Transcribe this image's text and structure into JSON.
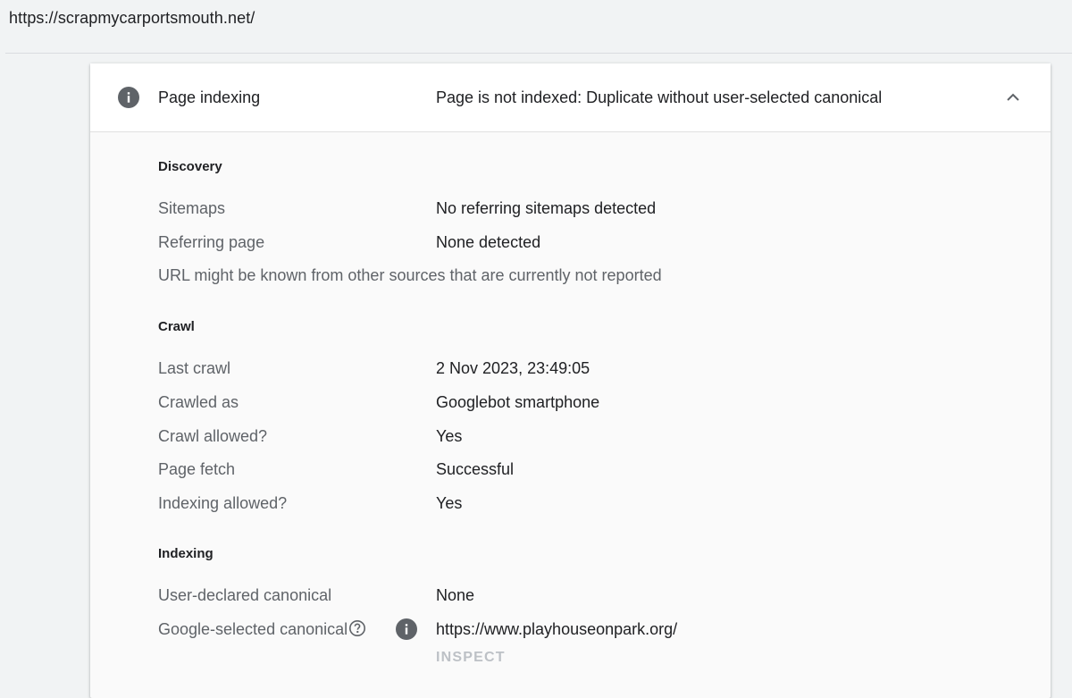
{
  "page_url": "https://scrapmycarportsmouth.net/",
  "panel": {
    "title": "Page indexing",
    "status": "Page is not indexed: Duplicate without user-selected canonical"
  },
  "discovery": {
    "heading": "Discovery",
    "sitemaps_label": "Sitemaps",
    "sitemaps_value": "No referring sitemaps detected",
    "referring_label": "Referring page",
    "referring_value": "None detected",
    "note": "URL might be known from other sources that are currently not reported"
  },
  "crawl": {
    "heading": "Crawl",
    "last_crawl_label": "Last crawl",
    "last_crawl_value": "2 Nov 2023, 23:49:05",
    "crawled_as_label": "Crawled as",
    "crawled_as_value": "Googlebot smartphone",
    "crawl_allowed_label": "Crawl allowed?",
    "crawl_allowed_value": "Yes",
    "page_fetch_label": "Page fetch",
    "page_fetch_value": "Successful",
    "indexing_allowed_label": "Indexing allowed?",
    "indexing_allowed_value": "Yes"
  },
  "indexing": {
    "heading": "Indexing",
    "user_canonical_label": "User-declared canonical",
    "user_canonical_value": "None",
    "google_canonical_label": "Google-selected canonical",
    "google_canonical_value": "https://www.playhouseonpark.org/",
    "inspect_label": "INSPECT"
  },
  "icons": {
    "header": "info-icon",
    "collapse": "chevron-up-icon",
    "help": "help-circle-icon",
    "canonical_info": "info-icon"
  },
  "colors": {
    "background": "#f1f3f4",
    "card": "#fafafa",
    "label_text": "#5f6368",
    "inspect_disabled": "#bdc1c6"
  }
}
